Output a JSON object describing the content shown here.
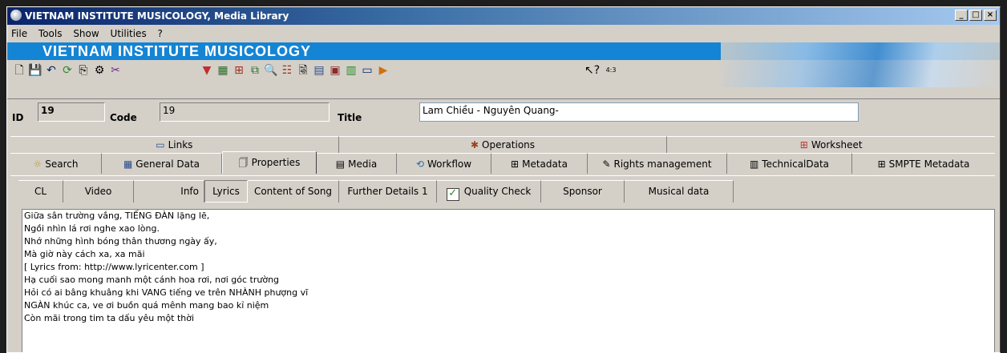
{
  "window": {
    "title": "VIETNAM INSTITUTE MUSICOLOGY, Media Library"
  },
  "menu": [
    "File",
    "Tools",
    "Show",
    "Utilities",
    "?"
  ],
  "banner": {
    "text": "VIETNAM INSTITUTE MUSICOLOGY"
  },
  "toolbar": {
    "aspect_label": "4:3"
  },
  "record": {
    "id_label": "ID",
    "id_value": "19",
    "code_label": "Code",
    "code_value": "19",
    "title_label": "Title",
    "title_value": "Lam Chiều - Nguyên Quang-"
  },
  "tabs_row1": [
    "Links",
    "Operations",
    "Worksheet"
  ],
  "tabs_row2": [
    "Search",
    "General Data",
    "Properties",
    "Media",
    "Workflow",
    "Metadata",
    "Rights management",
    "TechnicalData",
    "SMPTE Metadata"
  ],
  "active_tab": "Properties",
  "subtabs": [
    "CL",
    "Video",
    "Info",
    "Lyrics",
    "Content of Song",
    "Further Details 1",
    "Quality Check",
    "Sponsor",
    "Musical data"
  ],
  "active_subtab": "Lyrics",
  "lyrics": [
    "Giữa sân trường vắng, TIẾNG ĐÀN lặng lẽ,",
    "Ngồi nhìn lá rơi nghe xao lòng.",
    "Nhớ những hình bóng thân thương ngày ấy,",
    "Mà giờ này cách xa, xa mãi",
    "",
    "[ Lyrics from: http://www.lyricenter.com ]",
    "Hạ cuối sao mong manh một cánh hoa rơi, nơi góc trường",
    "Hỏi có ai bâng khuâng khi VANG tiếng ve trên NHÀNH phượng vĩ",
    "NGÀN khúc ca, ve ơi buồn quá mênh mang bao kỉ niệm",
    "Còn mãi trong tim ta dấu yêu một thời"
  ]
}
